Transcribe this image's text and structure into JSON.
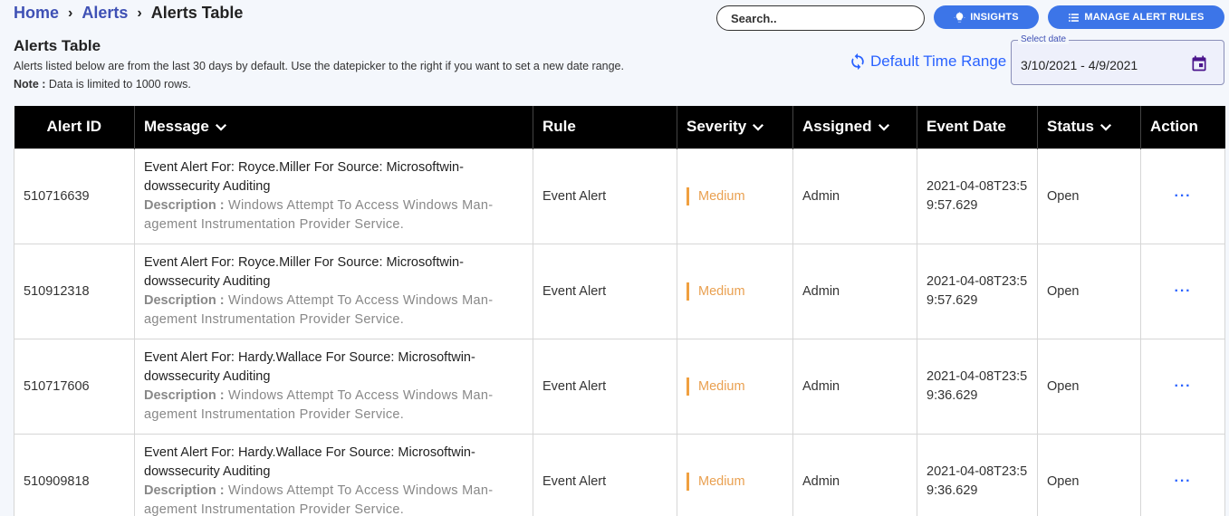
{
  "breadcrumb": {
    "items": [
      "Home",
      "Alerts"
    ],
    "separator": "›",
    "current": "Alerts Table"
  },
  "search": {
    "placeholder": "Search.."
  },
  "buttons": {
    "insights": "INSIGHTS",
    "manage_alert_rules": "MANAGE ALERT RULES"
  },
  "page": {
    "title": "Alerts Table",
    "description": "Alerts listed below are from the last 30 days by default. Use the datepicker to the right if you want to set a new date range.",
    "note_label": "Note :",
    "note_text": " Data is limited to 1000 rows."
  },
  "default_time_range": "Default Time Range",
  "datepicker": {
    "label": "Select date",
    "value": "3/10/2021 - 4/9/2021"
  },
  "table": {
    "columns": [
      "Alert ID",
      "Message",
      "Rule",
      "Severity",
      "Assigned",
      "Event Date",
      "Status",
      "Action"
    ],
    "rows": [
      {
        "alert_id": "510716639",
        "message_title": "Event Alert For: Royce.Miller For Source: Microsoftwin-dowssecurity Auditing",
        "description_label": "Description :",
        "description": " Windows Attempt To Access Windows Man-agement Instrumentation Provider Service.",
        "rule": "Event Alert",
        "severity": "Medium",
        "assigned": "Admin",
        "event_date": "2021-04-08T23:59:57.629",
        "status": "Open",
        "action": "···"
      },
      {
        "alert_id": "510912318",
        "message_title": "Event Alert For: Royce.Miller For Source: Microsoftwin-dowssecurity Auditing",
        "description_label": "Description :",
        "description": " Windows Attempt To Access Windows Man-agement Instrumentation Provider Service.",
        "rule": "Event Alert",
        "severity": "Medium",
        "assigned": "Admin",
        "event_date": "2021-04-08T23:59:57.629",
        "status": "Open",
        "action": "···"
      },
      {
        "alert_id": "510717606",
        "message_title": "Event Alert For: Hardy.Wallace For Source: Microsoftwin-dowssecurity Auditing",
        "description_label": "Description :",
        "description": " Windows Attempt To Access Windows Man-agement Instrumentation Provider Service.",
        "rule": "Event Alert",
        "severity": "Medium",
        "assigned": "Admin",
        "event_date": "2021-04-08T23:59:36.629",
        "status": "Open",
        "action": "···"
      },
      {
        "alert_id": "510909818",
        "message_title": "Event Alert For: Hardy.Wallace For Source: Microsoftwin-dowssecurity Auditing",
        "description_label": "Description :",
        "description": " Windows Attempt To Access Windows Man-agement Instrumentation Provider Service.",
        "rule": "Event Alert",
        "severity": "Medium",
        "assigned": "Admin",
        "event_date": "2021-04-08T23:59:36.629",
        "status": "Open",
        "action": "···"
      }
    ]
  },
  "colors": {
    "link": "#3f51b5",
    "button": "#3c75e8",
    "accent": "#2962ff",
    "severity_medium": "#e9a050",
    "header_bg": "#000000"
  }
}
